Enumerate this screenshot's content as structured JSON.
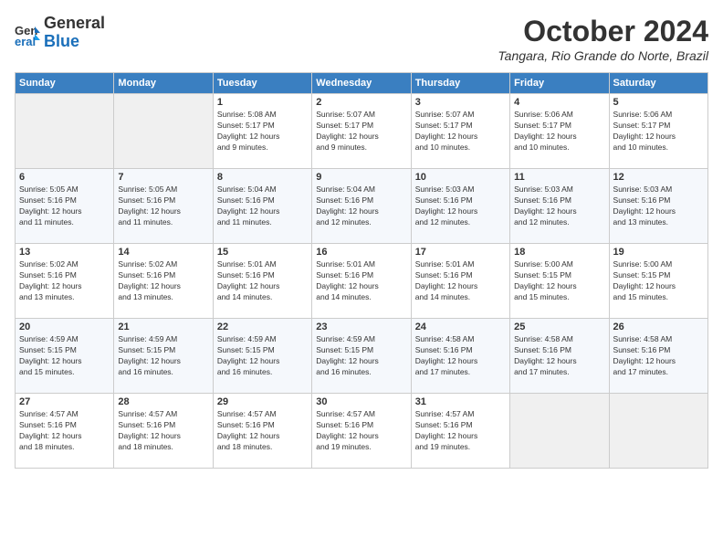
{
  "logo": {
    "general": "General",
    "blue": "Blue"
  },
  "header": {
    "month": "October 2024",
    "location": "Tangara, Rio Grande do Norte, Brazil"
  },
  "weekdays": [
    "Sunday",
    "Monday",
    "Tuesday",
    "Wednesday",
    "Thursday",
    "Friday",
    "Saturday"
  ],
  "weeks": [
    [
      {
        "day": "",
        "info": ""
      },
      {
        "day": "",
        "info": ""
      },
      {
        "day": "1",
        "info": "Sunrise: 5:08 AM\nSunset: 5:17 PM\nDaylight: 12 hours\nand 9 minutes."
      },
      {
        "day": "2",
        "info": "Sunrise: 5:07 AM\nSunset: 5:17 PM\nDaylight: 12 hours\nand 9 minutes."
      },
      {
        "day": "3",
        "info": "Sunrise: 5:07 AM\nSunset: 5:17 PM\nDaylight: 12 hours\nand 10 minutes."
      },
      {
        "day": "4",
        "info": "Sunrise: 5:06 AM\nSunset: 5:17 PM\nDaylight: 12 hours\nand 10 minutes."
      },
      {
        "day": "5",
        "info": "Sunrise: 5:06 AM\nSunset: 5:17 PM\nDaylight: 12 hours\nand 10 minutes."
      }
    ],
    [
      {
        "day": "6",
        "info": "Sunrise: 5:05 AM\nSunset: 5:16 PM\nDaylight: 12 hours\nand 11 minutes."
      },
      {
        "day": "7",
        "info": "Sunrise: 5:05 AM\nSunset: 5:16 PM\nDaylight: 12 hours\nand 11 minutes."
      },
      {
        "day": "8",
        "info": "Sunrise: 5:04 AM\nSunset: 5:16 PM\nDaylight: 12 hours\nand 11 minutes."
      },
      {
        "day": "9",
        "info": "Sunrise: 5:04 AM\nSunset: 5:16 PM\nDaylight: 12 hours\nand 12 minutes."
      },
      {
        "day": "10",
        "info": "Sunrise: 5:03 AM\nSunset: 5:16 PM\nDaylight: 12 hours\nand 12 minutes."
      },
      {
        "day": "11",
        "info": "Sunrise: 5:03 AM\nSunset: 5:16 PM\nDaylight: 12 hours\nand 12 minutes."
      },
      {
        "day": "12",
        "info": "Sunrise: 5:03 AM\nSunset: 5:16 PM\nDaylight: 12 hours\nand 13 minutes."
      }
    ],
    [
      {
        "day": "13",
        "info": "Sunrise: 5:02 AM\nSunset: 5:16 PM\nDaylight: 12 hours\nand 13 minutes."
      },
      {
        "day": "14",
        "info": "Sunrise: 5:02 AM\nSunset: 5:16 PM\nDaylight: 12 hours\nand 13 minutes."
      },
      {
        "day": "15",
        "info": "Sunrise: 5:01 AM\nSunset: 5:16 PM\nDaylight: 12 hours\nand 14 minutes."
      },
      {
        "day": "16",
        "info": "Sunrise: 5:01 AM\nSunset: 5:16 PM\nDaylight: 12 hours\nand 14 minutes."
      },
      {
        "day": "17",
        "info": "Sunrise: 5:01 AM\nSunset: 5:16 PM\nDaylight: 12 hours\nand 14 minutes."
      },
      {
        "day": "18",
        "info": "Sunrise: 5:00 AM\nSunset: 5:15 PM\nDaylight: 12 hours\nand 15 minutes."
      },
      {
        "day": "19",
        "info": "Sunrise: 5:00 AM\nSunset: 5:15 PM\nDaylight: 12 hours\nand 15 minutes."
      }
    ],
    [
      {
        "day": "20",
        "info": "Sunrise: 4:59 AM\nSunset: 5:15 PM\nDaylight: 12 hours\nand 15 minutes."
      },
      {
        "day": "21",
        "info": "Sunrise: 4:59 AM\nSunset: 5:15 PM\nDaylight: 12 hours\nand 16 minutes."
      },
      {
        "day": "22",
        "info": "Sunrise: 4:59 AM\nSunset: 5:15 PM\nDaylight: 12 hours\nand 16 minutes."
      },
      {
        "day": "23",
        "info": "Sunrise: 4:59 AM\nSunset: 5:15 PM\nDaylight: 12 hours\nand 16 minutes."
      },
      {
        "day": "24",
        "info": "Sunrise: 4:58 AM\nSunset: 5:16 PM\nDaylight: 12 hours\nand 17 minutes."
      },
      {
        "day": "25",
        "info": "Sunrise: 4:58 AM\nSunset: 5:16 PM\nDaylight: 12 hours\nand 17 minutes."
      },
      {
        "day": "26",
        "info": "Sunrise: 4:58 AM\nSunset: 5:16 PM\nDaylight: 12 hours\nand 17 minutes."
      }
    ],
    [
      {
        "day": "27",
        "info": "Sunrise: 4:57 AM\nSunset: 5:16 PM\nDaylight: 12 hours\nand 18 minutes."
      },
      {
        "day": "28",
        "info": "Sunrise: 4:57 AM\nSunset: 5:16 PM\nDaylight: 12 hours\nand 18 minutes."
      },
      {
        "day": "29",
        "info": "Sunrise: 4:57 AM\nSunset: 5:16 PM\nDaylight: 12 hours\nand 18 minutes."
      },
      {
        "day": "30",
        "info": "Sunrise: 4:57 AM\nSunset: 5:16 PM\nDaylight: 12 hours\nand 19 minutes."
      },
      {
        "day": "31",
        "info": "Sunrise: 4:57 AM\nSunset: 5:16 PM\nDaylight: 12 hours\nand 19 minutes."
      },
      {
        "day": "",
        "info": ""
      },
      {
        "day": "",
        "info": ""
      }
    ]
  ]
}
